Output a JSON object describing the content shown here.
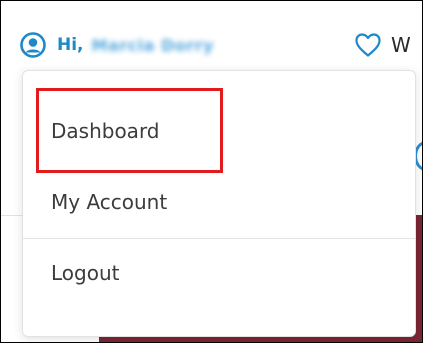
{
  "header": {
    "greeting": "Hi,",
    "user_name": "Marcia Dorry",
    "wishlist_label": "W"
  },
  "dropdown": {
    "items": [
      {
        "label": "Dashboard"
      },
      {
        "label": "My Account"
      },
      {
        "label": "Logout"
      }
    ]
  },
  "colors": {
    "accent": "#1e88c9",
    "highlight": "#e21c1c",
    "banner": "#7b2633"
  },
  "icons": {
    "user": "user-circle-icon",
    "wishlist": "heart-outline-icon"
  }
}
